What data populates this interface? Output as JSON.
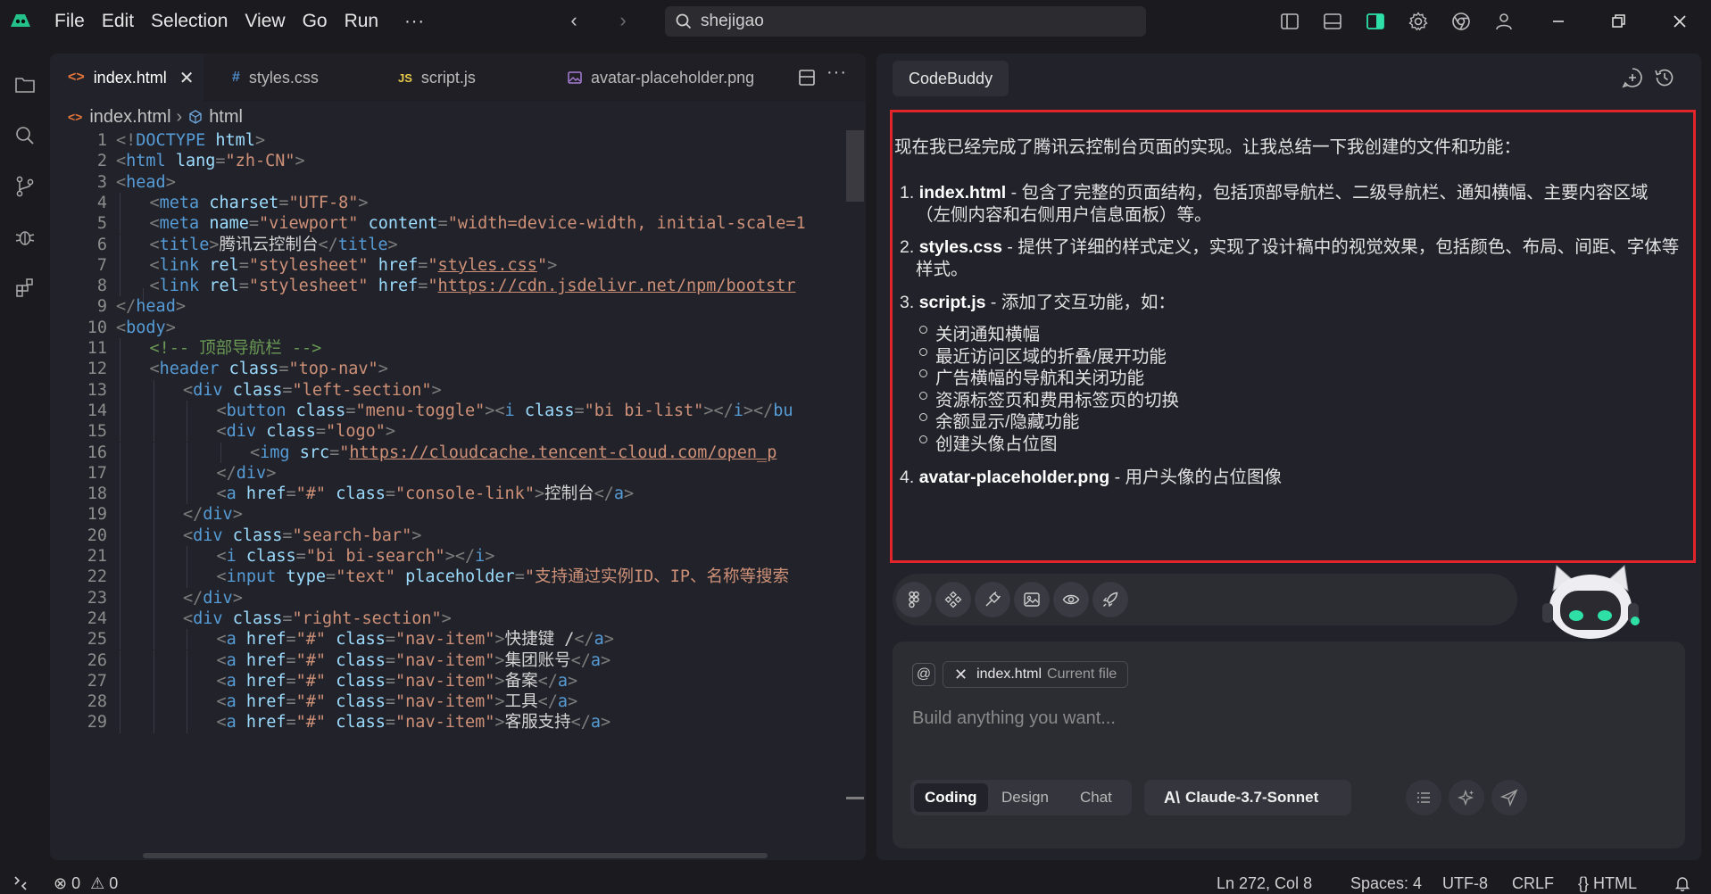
{
  "menu": [
    "File",
    "Edit",
    "Selection",
    "View",
    "Go",
    "Run"
  ],
  "menu_more": "···",
  "search": {
    "value": "shejigao"
  },
  "tabs": [
    {
      "icon": "<>",
      "label": "index.html"
    },
    {
      "icon": "#",
      "label": "styles.css"
    },
    {
      "icon": "JS",
      "label": "script.js"
    },
    {
      "icon": "img",
      "label": "avatar-placeholder.png"
    }
  ],
  "breadcrumb": {
    "file": "index.html",
    "symbol": "html"
  },
  "code_lines": [
    {
      "n": "1",
      "i": 0,
      "t": "<!DOCTYPE html>"
    },
    {
      "n": "2",
      "i": 0,
      "t": "<html lang=\"zh-CN\">"
    },
    {
      "n": "3",
      "i": 0,
      "t": "<head>"
    },
    {
      "n": "4",
      "i": 1,
      "t": "<meta charset=\"UTF-8\">"
    },
    {
      "n": "5",
      "i": 1,
      "t": "<meta name=\"viewport\" content=\"width=device-width, initial-scale=1"
    },
    {
      "n": "6",
      "i": 1,
      "t": "<title>腾讯云控制台</title>"
    },
    {
      "n": "7",
      "i": 1,
      "t": "<link rel=\"stylesheet\" href=\"styles.css\">"
    },
    {
      "n": "8",
      "i": 1,
      "t": "<link rel=\"stylesheet\" href=\"https://cdn.jsdelivr.net/npm/bootstra"
    },
    {
      "n": "9",
      "i": 0,
      "t": "</head>"
    },
    {
      "n": "10",
      "i": 0,
      "t": "<body>"
    },
    {
      "n": "11",
      "i": 1,
      "t": "<!-- 顶部导航栏 -->"
    },
    {
      "n": "12",
      "i": 1,
      "t": "<header class=\"top-nav\">"
    },
    {
      "n": "13",
      "i": 2,
      "t": "<div class=\"left-section\">"
    },
    {
      "n": "14",
      "i": 3,
      "t": "<button class=\"menu-toggle\"><i class=\"bi bi-list\"></i></bu"
    },
    {
      "n": "15",
      "i": 3,
      "t": "<div class=\"logo\">"
    },
    {
      "n": "16",
      "i": 4,
      "t": "<img src=\"https://cloudcache.tencent-cloud.com/open_pr"
    },
    {
      "n": "17",
      "i": 3,
      "t": "</div>"
    },
    {
      "n": "18",
      "i": 3,
      "t": "<a href=\"#\" class=\"console-link\">控制台</a>"
    },
    {
      "n": "19",
      "i": 2,
      "t": "</div>"
    },
    {
      "n": "20",
      "i": 2,
      "t": "<div class=\"search-bar\">"
    },
    {
      "n": "21",
      "i": 3,
      "t": "<i class=\"bi bi-search\"></i>"
    },
    {
      "n": "22",
      "i": 3,
      "t": "<input type=\"text\" placeholder=\"支持通过实例ID、IP、名称等搜索"
    },
    {
      "n": "23",
      "i": 2,
      "t": "</div>"
    },
    {
      "n": "24",
      "i": 2,
      "t": "<div class=\"right-section\">"
    },
    {
      "n": "25",
      "i": 3,
      "t": "<a href=\"#\" class=\"nav-item\">快捷键 /</a>"
    },
    {
      "n": "26",
      "i": 3,
      "t": "<a href=\"#\" class=\"nav-item\">集团账号</a>"
    },
    {
      "n": "27",
      "i": 3,
      "t": "<a href=\"#\" class=\"nav-item\">备案</a>"
    },
    {
      "n": "28",
      "i": 3,
      "t": "<a href=\"#\" class=\"nav-item\">工具</a>"
    },
    {
      "n": "29",
      "i": 3,
      "t": "<a href=\"#\" class=\"nav-item\">客服支持</a>"
    }
  ],
  "chat": {
    "title": "CodeBuddy",
    "intro": "现在我已经完成了腾讯云控制台页面的实现。让我总结一下我创建的文件和功能：",
    "items": [
      {
        "num": "1.",
        "name": "index.html",
        "desc": " - 包含了完整的页面结构，包括顶部导航栏、二级导航栏、通知横幅、主要内容区域",
        "cont": "（左侧内容和右侧用户信息面板）等。"
      },
      {
        "num": "2.",
        "name": "styles.css",
        "desc": " - 提供了详细的样式定义，实现了设计稿中的视觉效果，包括颜色、布局、间距、字体等",
        "cont": "样式。"
      },
      {
        "num": "3.",
        "name": "script.js",
        "desc": " - 添加了交互功能，如：",
        "cont": ""
      },
      {
        "num": "4.",
        "name": "avatar-placeholder.png",
        "desc": " - 用户头像的占位图像",
        "cont": ""
      }
    ],
    "subitems": [
      "关闭通知横幅",
      "最近访问区域的折叠/展开功能",
      "广告横幅的导航和关闭功能",
      "资源标签页和费用标签页的切换",
      "余额显示/隐藏功能",
      "创建头像占位图"
    ],
    "context_file": "index.html",
    "context_label": "Current file",
    "placeholder": "Build anything you want...",
    "modes": [
      "Coding",
      "Design",
      "Chat"
    ],
    "model": "Claude-3.7-Sonnet"
  },
  "status": {
    "errors": "0",
    "warnings": "0",
    "position": "Ln 272, Col 8",
    "spaces": "Spaces: 4",
    "encoding": "UTF-8",
    "eol": "CRLF",
    "language": "HTML",
    "language_icon": "{}"
  },
  "colors": {
    "accent_red": "#e0262b",
    "tag": "#569cd6",
    "attr": "#9cdcfe",
    "string": "#ce9178",
    "comment": "#6a9955",
    "mascot_eyes": "#2ee0a6"
  }
}
